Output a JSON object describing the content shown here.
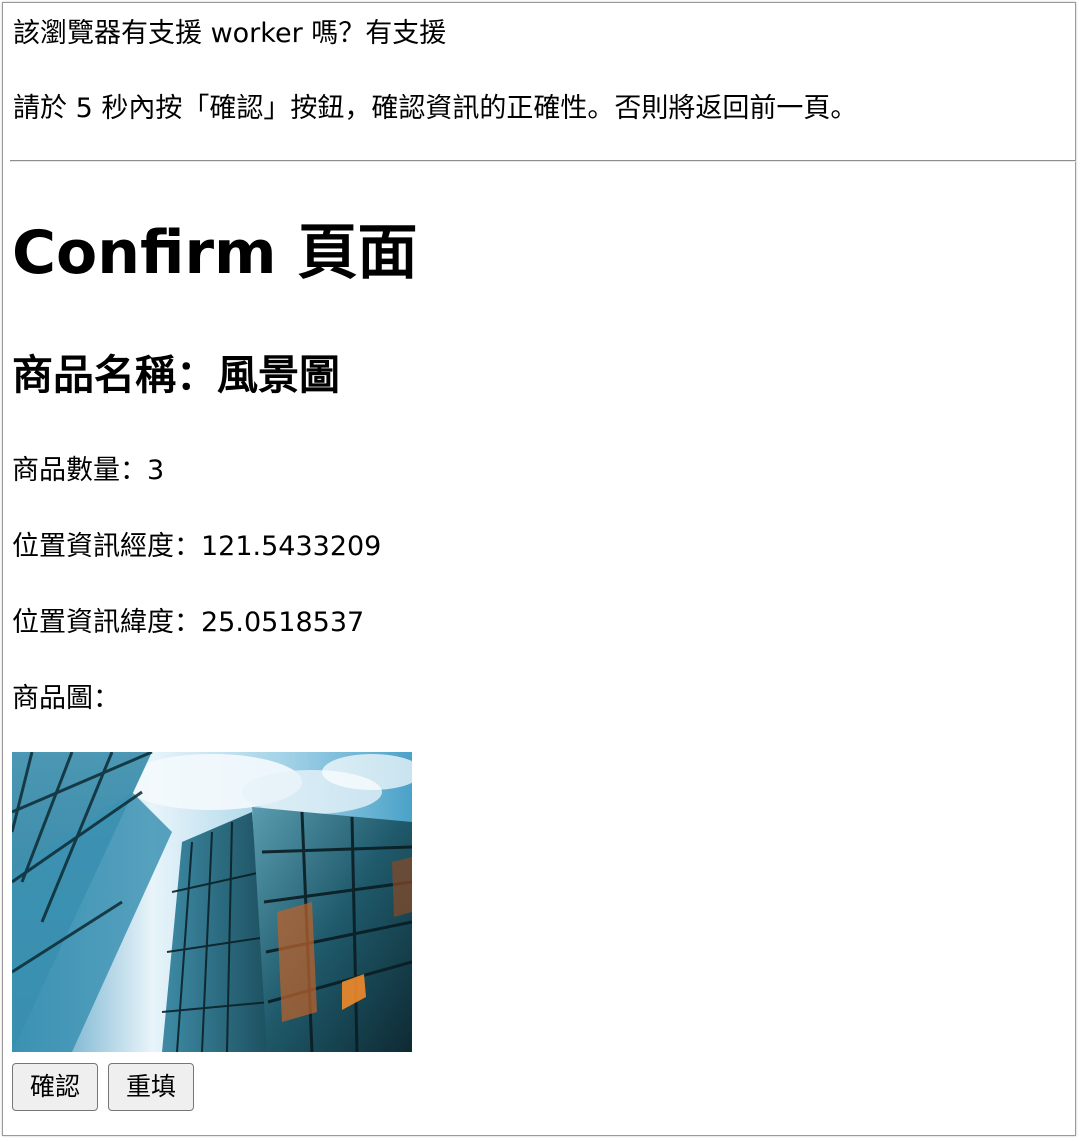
{
  "messages": {
    "worker_support": "該瀏覽器有支援 worker 嗎？有支援",
    "countdown": "請於 5 秒內按「確認」按鈕，確認資訊的正確性。否則將返回前一頁。"
  },
  "page": {
    "title": "Confirm 頁面"
  },
  "product": {
    "name": "商品名稱：風景圖",
    "quantity": "商品數量：3",
    "longitude": "位置資訊經度：121.5433209",
    "latitude": "位置資訊緯度：25.0518537",
    "image_label": "商品圖："
  },
  "buttons": {
    "confirm": "確認",
    "reset": "重填"
  },
  "colors": {
    "border": "#9a9a9a",
    "divider": "#8e8e8e",
    "button_bg": "#efefef",
    "button_border": "#767676",
    "sky": "#6fb8d8",
    "glass": "#2c6f86"
  }
}
